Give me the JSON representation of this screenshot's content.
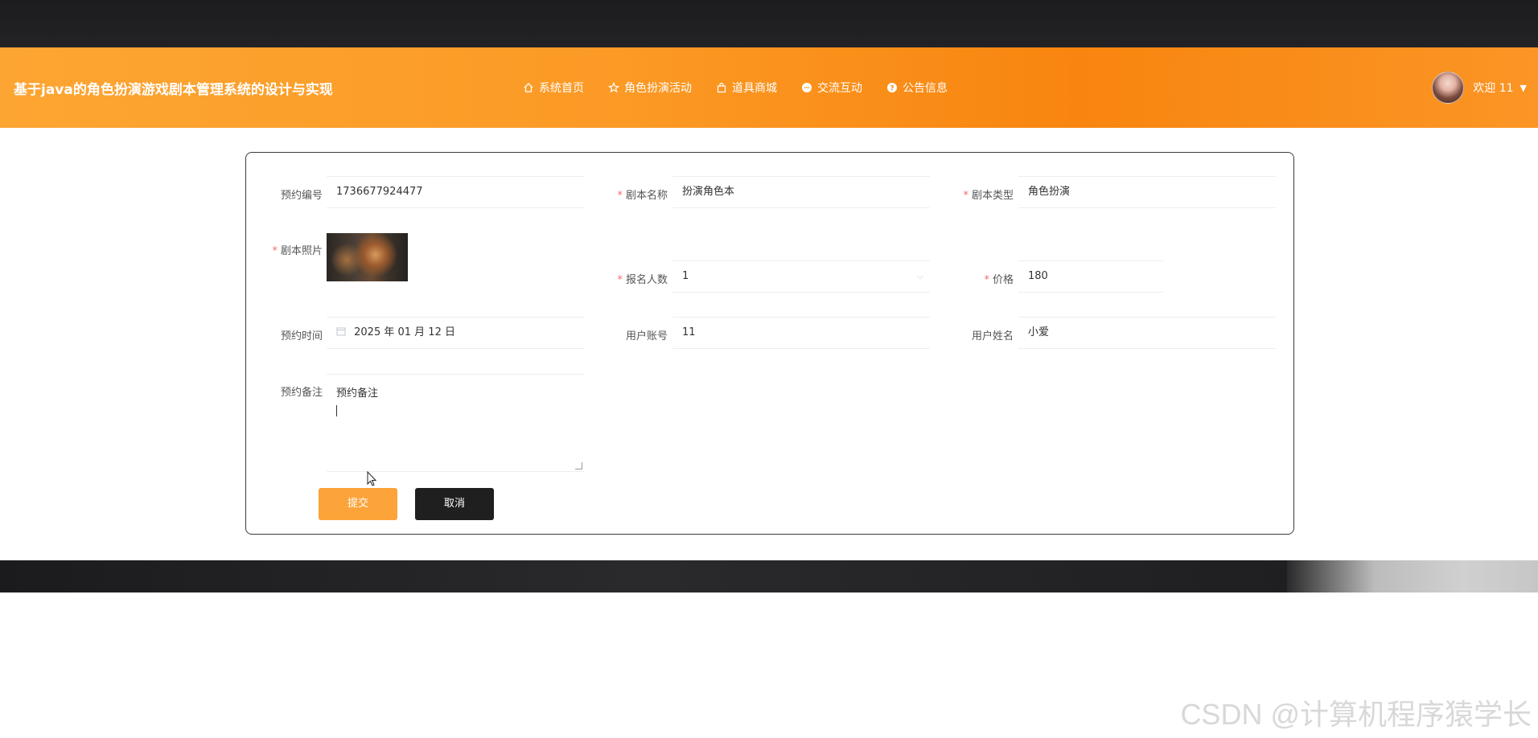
{
  "header": {
    "title": "基于java的角色扮演游戏剧本管理系统的设计与实现",
    "nav": [
      {
        "label": "系统首页",
        "icon": "home-icon"
      },
      {
        "label": "角色扮演活动",
        "icon": "star-icon"
      },
      {
        "label": "道具商城",
        "icon": "bag-icon"
      },
      {
        "label": "交流互动",
        "icon": "chat-icon"
      },
      {
        "label": "公告信息",
        "icon": "question-icon"
      }
    ],
    "user": {
      "greeting": "欢迎 11",
      "avatar_icon": "avatar-icon"
    }
  },
  "form": {
    "booking_no": {
      "label": "预约编号",
      "value": "1736677924477"
    },
    "script_name": {
      "label": "剧本名称",
      "value": "扮演角色本"
    },
    "script_type": {
      "label": "剧本类型",
      "value": "角色扮演"
    },
    "script_photo": {
      "label": "剧本照片"
    },
    "participants": {
      "label": "报名人数",
      "value": "1"
    },
    "price": {
      "label": "价格",
      "value": "180"
    },
    "booking_time": {
      "label": "预约时间",
      "value": "2025 年 01 月 12 日"
    },
    "user_account": {
      "label": "用户账号",
      "value": "11"
    },
    "user_name": {
      "label": "用户姓名",
      "value": "小爱"
    },
    "booking_note": {
      "label": "预约备注",
      "value": "预约备注"
    },
    "submit_label": "提交",
    "cancel_label": "取消"
  },
  "watermark": "CSDN @计算机程序猿学长",
  "colors": {
    "header": "#fb9a25",
    "submit": "#fca33a",
    "cancel": "#1f1f1f"
  }
}
